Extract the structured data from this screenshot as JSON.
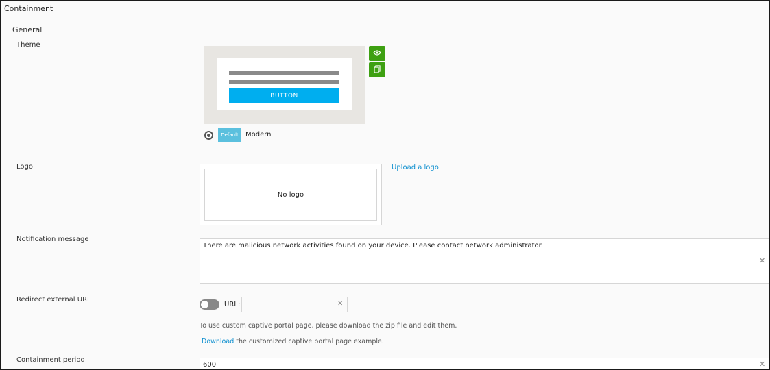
{
  "page": {
    "title": "Containment",
    "section": "General"
  },
  "theme": {
    "label": "Theme",
    "preview_button": "BUTTON",
    "badge": "Default",
    "name": "Modern",
    "selected": true,
    "icons": [
      "eye-icon",
      "copy-icon"
    ],
    "accent_color": "#3ea012",
    "preview_button_color": "#00aeef"
  },
  "logo": {
    "label": "Logo",
    "placeholder": "No logo",
    "upload_link": "Upload a logo"
  },
  "notification": {
    "label": "Notification message",
    "value": "There are malicious network activities found on your device. Please contact network administrator."
  },
  "redirect": {
    "label": "Redirect external URL",
    "enabled": false,
    "url_label": "URL:",
    "url_value": "",
    "help_text": "To use custom captive portal page, please download the zip file and edit them.",
    "download_link": "Download",
    "download_suffix": " the customized captive portal page example."
  },
  "containment_period": {
    "label": "Containment period",
    "value": "600"
  }
}
